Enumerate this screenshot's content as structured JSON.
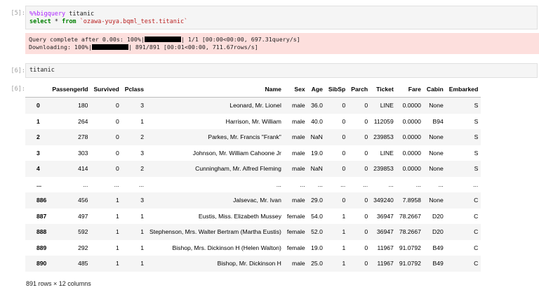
{
  "cell5": {
    "in_prompt": "[5]:",
    "magic": "%%bigquery",
    "line1_rest": " titanic",
    "kw_select": "select",
    "line2_mid": " * ",
    "kw_from": "from",
    "line2_sp": " ",
    "table_ref": "`ozawa-yuya.bqml_test.titanic`",
    "stderr_line1_pre": "Query complete after 0.00s: 100%|",
    "stderr_line1_post": "| 1/1 [00:00<00:00, 697.31query/s]",
    "stderr_line2_pre": "Downloading: 100%|",
    "stderr_line2_post": "| 891/891 [00:01<00:00, 711.67rows/s]"
  },
  "cell6": {
    "in_prompt": "[6]:",
    "code": "titanic",
    "out_prompt": "[6]:"
  },
  "dataframe": {
    "columns": [
      "",
      "PassengerId",
      "Survived",
      "Pclass",
      "Name",
      "Sex",
      "Age",
      "SibSp",
      "Parch",
      "Ticket",
      "Fare",
      "Cabin",
      "Embarked"
    ],
    "rows": [
      [
        "0",
        "180",
        "0",
        "3",
        "Leonard, Mr. Lionel",
        "male",
        "36.0",
        "0",
        "0",
        "LINE",
        "0.0000",
        "None",
        "S"
      ],
      [
        "1",
        "264",
        "0",
        "1",
        "Harrison, Mr. William",
        "male",
        "40.0",
        "0",
        "0",
        "112059",
        "0.0000",
        "B94",
        "S"
      ],
      [
        "2",
        "278",
        "0",
        "2",
        "Parkes, Mr. Francis \"Frank\"",
        "male",
        "NaN",
        "0",
        "0",
        "239853",
        "0.0000",
        "None",
        "S"
      ],
      [
        "3",
        "303",
        "0",
        "3",
        "Johnson, Mr. William Cahoone Jr",
        "male",
        "19.0",
        "0",
        "0",
        "LINE",
        "0.0000",
        "None",
        "S"
      ],
      [
        "4",
        "414",
        "0",
        "2",
        "Cunningham, Mr. Alfred Fleming",
        "male",
        "NaN",
        "0",
        "0",
        "239853",
        "0.0000",
        "None",
        "S"
      ],
      [
        "...",
        "...",
        "...",
        "...",
        "...",
        "...",
        "...",
        "...",
        "...",
        "...",
        "...",
        "...",
        "..."
      ],
      [
        "886",
        "456",
        "1",
        "3",
        "Jalsevac, Mr. Ivan",
        "male",
        "29.0",
        "0",
        "0",
        "349240",
        "7.8958",
        "None",
        "C"
      ],
      [
        "887",
        "497",
        "1",
        "1",
        "Eustis, Miss. Elizabeth Mussey",
        "female",
        "54.0",
        "1",
        "0",
        "36947",
        "78.2667",
        "D20",
        "C"
      ],
      [
        "888",
        "592",
        "1",
        "1",
        "Stephenson, Mrs. Walter Bertram (Martha Eustis)",
        "female",
        "52.0",
        "1",
        "0",
        "36947",
        "78.2667",
        "D20",
        "C"
      ],
      [
        "889",
        "292",
        "1",
        "1",
        "Bishop, Mrs. Dickinson H (Helen Walton)",
        "female",
        "19.0",
        "1",
        "0",
        "11967",
        "91.0792",
        "B49",
        "C"
      ],
      [
        "890",
        "485",
        "1",
        "1",
        "Bishop, Mr. Dickinson H",
        "male",
        "25.0",
        "1",
        "0",
        "11967",
        "91.0792",
        "B49",
        "C"
      ]
    ],
    "shape_text": "891 rows × 12 columns"
  },
  "colors": {
    "stderr_bg": "#fddfdd",
    "code_bg": "#f5f5f5",
    "magic": "#aa22ff",
    "keyword": "#008000",
    "string": "#ba2121"
  }
}
